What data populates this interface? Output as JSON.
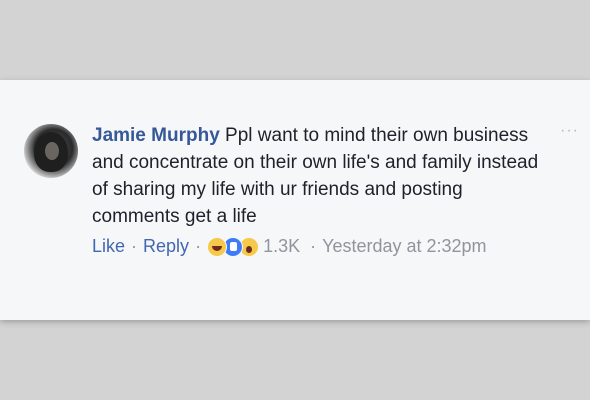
{
  "comment": {
    "author": "Jamie Murphy",
    "text": "Ppl want to mind their own business and concentrate on their own life's and family instead of sharing my life with ur friends and posting comments get a life"
  },
  "actions": {
    "like_label": "Like",
    "reply_label": "Reply",
    "separator": "·",
    "reaction_icons": [
      "haha-icon",
      "like-icon",
      "wow-icon"
    ],
    "reaction_count": "1.3K",
    "timestamp": "Yesterday at 2:32pm"
  },
  "menu": {
    "more_label": "···"
  },
  "colors": {
    "author": "#365899",
    "link": "#4267b2",
    "meta": "#90949c",
    "background": "#f6f7f9"
  }
}
